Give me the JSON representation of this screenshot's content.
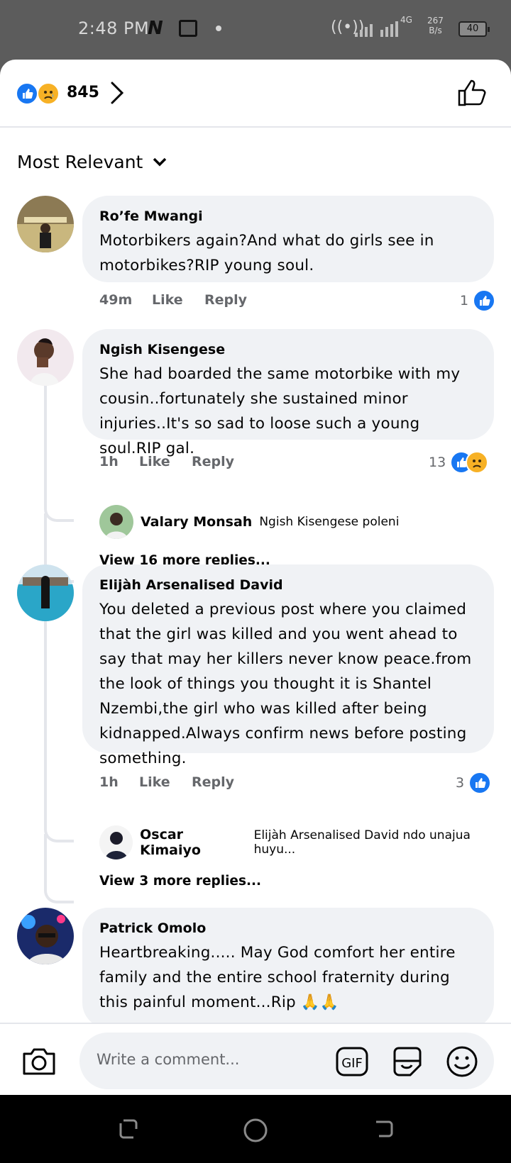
{
  "status_bar": {
    "time": "2:48 PM",
    "network": "4G",
    "speed_value": "267",
    "speed_unit": "B/s",
    "battery": "40"
  },
  "reactions": {
    "count": "845",
    "icons": [
      "like-icon",
      "sad-icon"
    ]
  },
  "sort": {
    "label": "Most Relevant"
  },
  "comments": [
    {
      "author": "Ro’fe Mwangi",
      "text": "Motorbikers again?And what do girls see in motorbikes?RIP young soul.",
      "time": "49m",
      "like_label": "Like",
      "reply_label": "Reply",
      "reaction_count": "1"
    },
    {
      "author": "Ngish Kisengese",
      "text": "She had boarded the same motorbike with my cousin..fortunately she sustained minor injuries..It's so sad to loose such a young soul.RIP gal.",
      "time": "1h",
      "like_label": "Like",
      "reply_label": "Reply",
      "reaction_count": "13",
      "reply": {
        "author": "Valary Monsah",
        "text": "Ngish Kisengese poleni"
      },
      "view_more": "View 16 more replies..."
    },
    {
      "author": "Elijàh Arsenalised David",
      "text": "You deleted a previous post where you claimed that the girl was killed and you went ahead to say that may her killers never know peace.from the look of things you thought it is Shantel Nzembi,the girl who was killed after being kidnapped.Always confirm news before posting something.",
      "time": "1h",
      "like_label": "Like",
      "reply_label": "Reply",
      "reaction_count": "3",
      "reply": {
        "author": "Oscar Kimaiyo",
        "text": "Elijàh Arsenalised David  ndo unajua huyu..."
      },
      "view_more": "View 3 more replies..."
    },
    {
      "author": "Patrick Omolo",
      "text": "Heartbreaking..... May God comfort her entire family and the entire school fraternity during this painful moment...Rip 🙏🙏"
    }
  ],
  "composer": {
    "placeholder": "Write a comment...",
    "gif_label": "GIF"
  },
  "colors": {
    "facebook_blue": "#1877f2",
    "bubble_gray": "#f0f2f5",
    "meta_gray": "#65676b"
  }
}
